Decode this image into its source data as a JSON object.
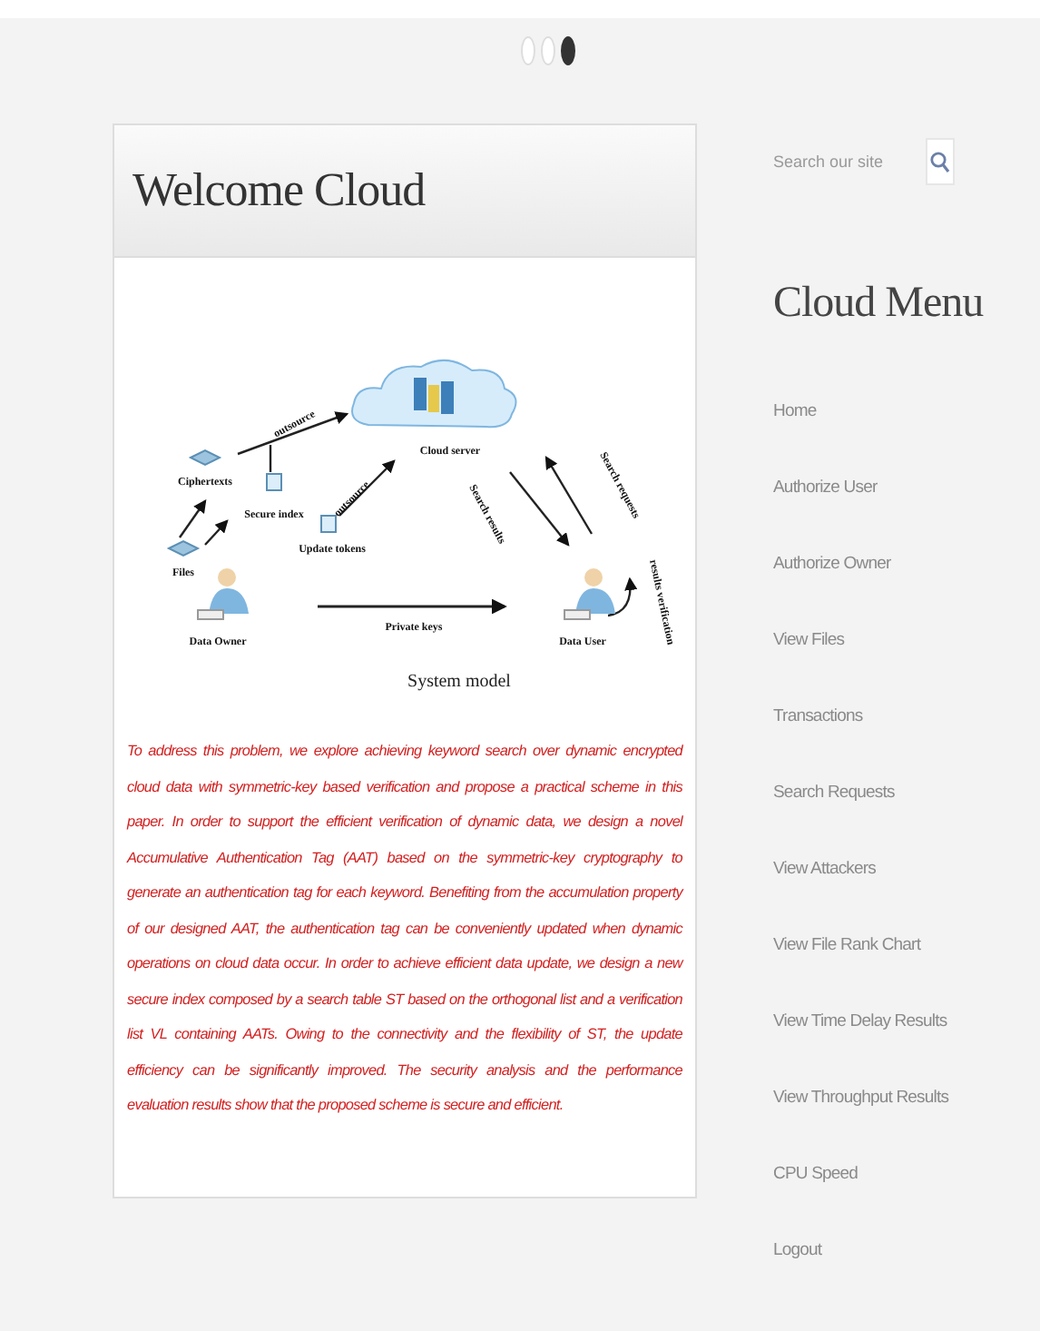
{
  "slider_dots": [
    {
      "selected": false
    },
    {
      "selected": false
    },
    {
      "selected": true
    }
  ],
  "main": {
    "title": "Welcome Cloud",
    "diagram": {
      "labels": [
        "Cloud server",
        "Ciphertexts",
        "Secure index",
        "Update tokens",
        "Files",
        "Data Owner",
        "Private keys",
        "Data User",
        "outsource",
        "outsource",
        "Search requests",
        "Search results",
        "results verification"
      ],
      "caption": "System model"
    },
    "paragraph": "To address this problem, we explore achieving keyword search over dynamic encrypted cloud data with symmetric-key based verification and propose a practical scheme in this paper. In order to support the efficient verification of dynamic data, we design a novel Accumulative Authentication Tag (AAT) based on the symmetric-key cryptography to generate an authentication tag for each keyword. Benefiting from the accumulation property of our designed AAT, the authentication tag can be conveniently updated when dynamic operations on cloud data occur. In order to achieve efficient data update, we design a new secure index composed by a search table ST based on the orthogonal list and a verification list VL containing AATs. Owing to the connectivity and the flexibility of ST, the update efficiency can be significantly improved. The security analysis and the performance evaluation results show that the proposed scheme is secure and efficient."
  },
  "sidebar": {
    "search": {
      "placeholder": "Search our site"
    },
    "menu_title": "Cloud Menu",
    "items": [
      "Home",
      "Authorize User",
      "Authorize Owner",
      "View Files",
      "Transactions",
      "Search Requests",
      "View Attackers",
      "View File Rank Chart",
      "View Time Delay Results",
      "View Throughput Results",
      "CPU Speed",
      "Logout"
    ]
  }
}
